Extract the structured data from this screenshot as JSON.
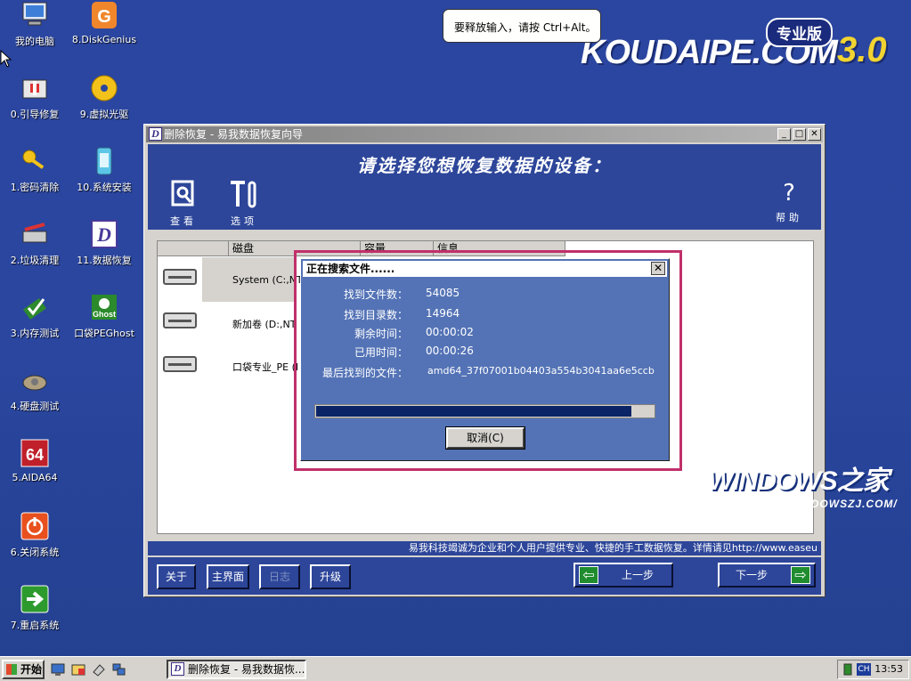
{
  "desktop": {
    "icons": [
      {
        "label": "我的电脑",
        "icon": "computer-icon"
      },
      {
        "label": "8.DiskGenius",
        "icon": "diskgenius-icon"
      },
      {
        "label": "0.引导修复",
        "icon": "boot-repair-icon"
      },
      {
        "label": "9.虚拟光驱",
        "icon": "virtual-drive-icon"
      },
      {
        "label": "1.密码清除",
        "icon": "key-icon"
      },
      {
        "label": "10.系统安装",
        "icon": "system-install-icon"
      },
      {
        "label": "2.垃圾清理",
        "icon": "cleanup-icon"
      },
      {
        "label": "11.数据恢复",
        "icon": "data-recovery-icon"
      },
      {
        "label": "3.内存测试",
        "icon": "memory-test-icon"
      },
      {
        "label": "口袋PEGhost",
        "icon": "ghost-icon"
      },
      {
        "label": "4.硬盘测试",
        "icon": "harddisk-test-icon"
      },
      {
        "label": "5.AIDA64",
        "icon": "aida64-icon"
      },
      {
        "label": "6.关闭系统",
        "icon": "power-icon"
      },
      {
        "label": "7.重启系统",
        "icon": "restart-icon"
      }
    ],
    "ghost_badge": "Ghost",
    "aida_badge": "64"
  },
  "brand": {
    "name": "KOUDAIPE.COM",
    "version": "3.0",
    "badge": "专业版"
  },
  "tooltip": {
    "text": "要释放输入，请按 Ctrl+Alt。"
  },
  "window": {
    "title": "删除恢复 - 易我数据恢复向导",
    "title_icon": "D",
    "prompt": "请选择您想恢复数据的设备：",
    "tools": {
      "view": "查看",
      "options": "选项",
      "help": "帮助"
    },
    "columns": [
      "磁盘",
      "容量",
      "信息"
    ],
    "drives": [
      {
        "name": "System (C:,NT"
      },
      {
        "name": "新加卷 (D:,NT"
      },
      {
        "name": "口袋专业_PE (I"
      }
    ],
    "info_bar": "易我科技竭诚为企业和个人用户提供专业、快捷的手工数据恢复。详情请见http://www.easeu",
    "buttons": {
      "about": "关于",
      "main": "主界面",
      "log": "日志",
      "upgrade": "升级",
      "prev": "上一步",
      "next": "下一步"
    }
  },
  "dialog": {
    "title": "正在搜索文件......",
    "rows": [
      {
        "label": "找到文件数：",
        "value": "54085"
      },
      {
        "label": "找到目录数：",
        "value": "14964"
      },
      {
        "label": "剩余时间：",
        "value": "00:00:02"
      },
      {
        "label": "已用时间：",
        "value": "00:00:26"
      },
      {
        "label": "最后找到的文件：",
        "value": "amd64_37f07001b04403a554b3041aa6e5ccb"
      }
    ],
    "progress": 0.93,
    "cancel": "取消(C)"
  },
  "logo": {
    "big": "WINDOWS之家",
    "url": "HTTP://WWW.WINDOWSZJ.COM/"
  },
  "taskbar": {
    "start": "开始",
    "task": "删除恢复 - 易我数据恢...",
    "lang": "CH",
    "clock": "13:53"
  },
  "colors": {
    "desktop": "#2a469f",
    "accent": "#2d469a",
    "highlight": "#c0306a",
    "progress": "#0a2466"
  }
}
